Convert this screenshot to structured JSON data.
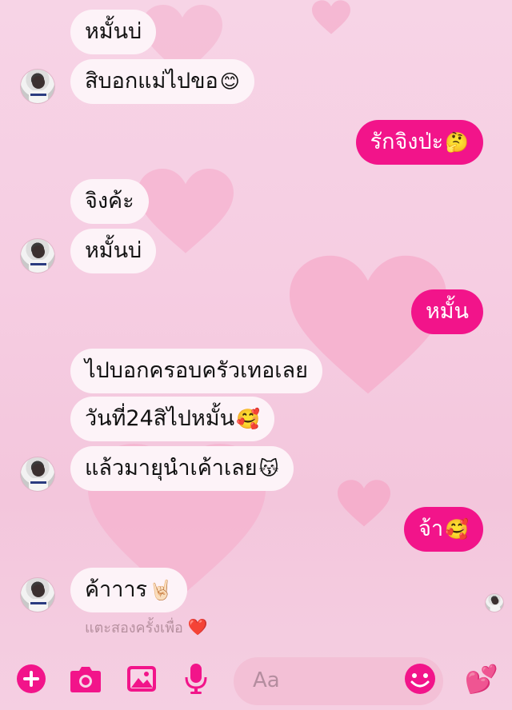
{
  "messages": [
    {
      "side": "in",
      "text": "หมั้นบ่"
    },
    {
      "side": "in",
      "text": "สิบอกแม่ไปขอ",
      "emoji": "😊"
    },
    {
      "side": "out",
      "text": "รักจิงป่ะ",
      "emoji": "🤔"
    },
    {
      "side": "in",
      "text": "จิงค้ะ"
    },
    {
      "side": "in",
      "text": "หมั้นบ่"
    },
    {
      "side": "out",
      "text": "หมั้น"
    },
    {
      "side": "in",
      "text": "ไปบอกครอบครัวเทอเลย"
    },
    {
      "side": "in",
      "text": "วันที่24สิไปหมั้น",
      "emoji": "🥰"
    },
    {
      "side": "in",
      "text": "แล้วมายุนำเค้าเลย",
      "emoji": "😽"
    },
    {
      "side": "out",
      "text": "จ้า",
      "emoji": "🥰"
    },
    {
      "side": "in",
      "text": "ค้าาาร",
      "emoji": "🤘🏻"
    }
  ],
  "hint": {
    "text": "แตะสองครั้งเพื่อ",
    "emoji": "❤️"
  },
  "composer": {
    "placeholder": "Aa",
    "colors": {
      "accent": "#f2148a",
      "field_bg": "#f3c0d6"
    },
    "icons": [
      "plus-icon",
      "camera-icon",
      "image-icon",
      "microphone-icon",
      "smiley-icon",
      "hearts-icon"
    ],
    "send_emoji": "💕"
  }
}
